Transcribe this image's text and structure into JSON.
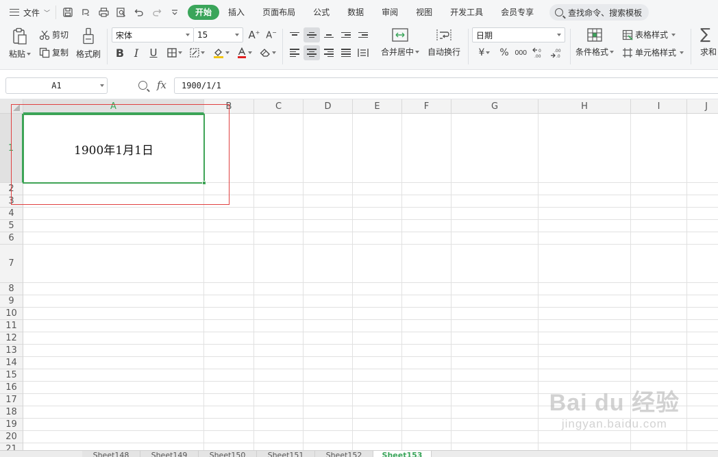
{
  "menubar": {
    "file_label": "文件",
    "tabs": [
      "开始",
      "插入",
      "页面布局",
      "公式",
      "数据",
      "审阅",
      "视图",
      "开发工具",
      "会员专享"
    ],
    "active_tab": 0,
    "search_label": "查找命令、搜索模板"
  },
  "ribbon": {
    "paste": "粘贴",
    "cut": "剪切",
    "copy": "复制",
    "format_painter": "格式刷",
    "font_name": "宋体",
    "font_size": "15",
    "bold": "B",
    "italic": "I",
    "underline": "U",
    "merge_center": "合并居中",
    "wrap_text": "自动换行",
    "number_format": "日期",
    "currency": "¥",
    "percent": "%",
    "thousands": "000",
    "conditional_format": "条件格式",
    "table_style": "表格样式",
    "cell_style": "单元格样式",
    "sum": "求和"
  },
  "formula_bar": {
    "name_box": "A1",
    "fx": "fx",
    "formula": "1900/1/1"
  },
  "grid": {
    "columns": [
      "A",
      "B",
      "C",
      "D",
      "E",
      "F",
      "G",
      "H",
      "I",
      "J"
    ],
    "rows": [
      "1",
      "2",
      "3",
      "4",
      "5",
      "6",
      "7",
      "8",
      "9",
      "10",
      "11",
      "12",
      "13",
      "14",
      "15",
      "16",
      "17",
      "18",
      "19",
      "20",
      "21"
    ],
    "selected_cell": "A1",
    "cell_A1_display": "1900年1月1日"
  },
  "sheets": {
    "tabs": [
      "Sheet148",
      "Sheet149",
      "Sheet150",
      "Sheet151",
      "Sheet152",
      "Sheet153"
    ],
    "active": "Sheet153"
  },
  "watermark": {
    "main": "Bai du 经验",
    "sub": "jingyan.baidu.com"
  },
  "colors": {
    "accent": "#3aa55a",
    "selection_border": "#3ea355",
    "annotation_red": "#e04040"
  }
}
